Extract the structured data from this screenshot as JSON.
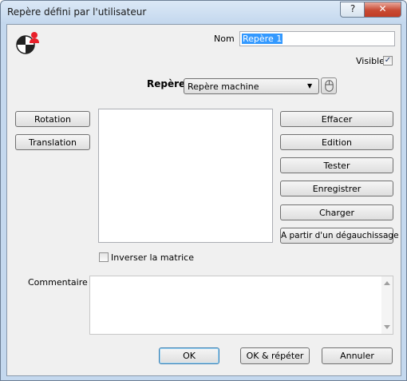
{
  "window": {
    "title": "Repère défini par l'utilisateur",
    "help_glyph": "?",
    "close_glyph": "✕"
  },
  "form": {
    "nom_label": "Nom",
    "nom_value": "Repère 1",
    "visible_label": "Visible",
    "visible_checked": "✓",
    "repere_label": "Repère",
    "repere_value": "Repère machine",
    "dropdown_arrow": "▼"
  },
  "left_buttons": [
    "Rotation",
    "Translation"
  ],
  "right_buttons": [
    "Effacer",
    "Edition",
    "Tester",
    "Enregistrer",
    "Charger",
    "A partir d'un dégauchissage"
  ],
  "invert_label": "Inverser la matrice",
  "commentaire_label": "Commentaire",
  "footer": {
    "ok": "OK",
    "ok_repeat": "OK & répéter",
    "cancel": "Annuler"
  },
  "icons": {
    "app": "user-frame-icon",
    "mouse": "mouse-icon"
  },
  "colors": {
    "accent_red": "#e8202a",
    "selection": "#3399ff"
  }
}
